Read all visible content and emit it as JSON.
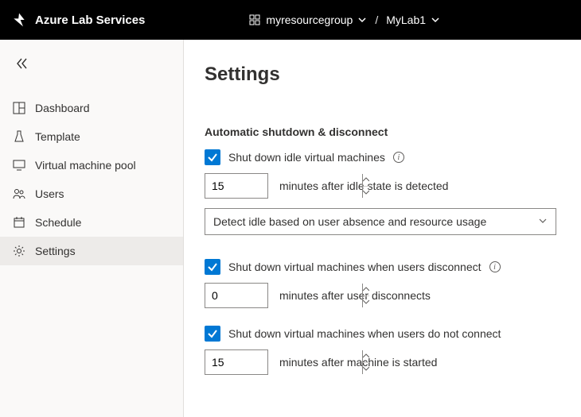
{
  "header": {
    "app_title": "Azure Lab Services",
    "resource_group": "myresourcegroup",
    "lab": "MyLab1",
    "separator": "/"
  },
  "sidebar": {
    "items": [
      {
        "label": "Dashboard"
      },
      {
        "label": "Template"
      },
      {
        "label": "Virtual machine pool"
      },
      {
        "label": "Users"
      },
      {
        "label": "Schedule"
      },
      {
        "label": "Settings"
      }
    ]
  },
  "main": {
    "title": "Settings",
    "section_title": "Automatic shutdown & disconnect",
    "idle": {
      "checkbox_label": "Shut down idle virtual machines",
      "minutes": "15",
      "minutes_suffix": "minutes after idle state is detected",
      "detect_mode": "Detect idle based on user absence and resource usage"
    },
    "disconnect": {
      "checkbox_label": "Shut down virtual machines when users disconnect",
      "minutes": "0",
      "minutes_suffix": "minutes after user disconnects"
    },
    "noconnect": {
      "checkbox_label": "Shut down virtual machines when users do not connect",
      "minutes": "15",
      "minutes_suffix": "minutes after machine is started"
    }
  }
}
